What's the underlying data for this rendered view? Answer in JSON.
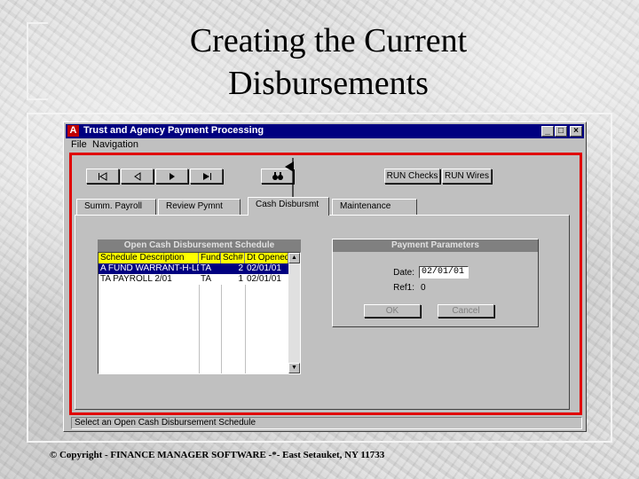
{
  "slide": {
    "title_line1": "Creating the Current",
    "title_line2": "Disbursements",
    "footer": "© Copyright - FINANCE MANAGER SOFTWARE -*- East Setauket, NY 11733"
  },
  "window": {
    "app_icon_letter": "A",
    "title": "Trust and Agency Payment Processing",
    "controls": {
      "minimize": "_",
      "maximize": "□",
      "close": "×"
    }
  },
  "menu": {
    "file": "File",
    "navigation": "Navigation"
  },
  "toolbar": {
    "nav_icons": [
      "first-record-icon",
      "previous-record-icon",
      "next-record-icon",
      "last-record-icon",
      "binoculars-icon"
    ],
    "run_checks": "RUN Checks",
    "run_wires": "RUN Wires"
  },
  "tabs": [
    {
      "label": "Summ. Payroll",
      "active": false
    },
    {
      "label": "Review Pymnt",
      "active": false
    },
    {
      "label": "Cash Disbursmt",
      "active": true
    },
    {
      "label": "Maintenance",
      "active": false
    }
  ],
  "schedule_grid": {
    "title": "Open Cash Disbursement Schedule",
    "columns": [
      "Schedule Description",
      "Fund",
      "Sch#",
      "Dt Opened"
    ],
    "header_color": "#ffff00",
    "selected_color": "#000080",
    "rows": [
      {
        "description": "A FUND WARRANT-H-LD",
        "fund": "TA",
        "sch": "2",
        "opened": "02/01/01",
        "selected": true
      },
      {
        "description": "TA PAYROLL 2/01",
        "fund": "TA",
        "sch": "1",
        "opened": "02/01/01",
        "selected": false
      }
    ]
  },
  "payment_parameters": {
    "title": "Payment Parameters",
    "date_label": "Date:",
    "date_value": "02/01/01",
    "refl_label": "Ref1:",
    "refl_value": "0",
    "ok": "OK",
    "cancel": "Cancel"
  },
  "status_bar": "Select an Open Cash Disbursement Schedule",
  "colors": {
    "highlight_frame": "#e00000",
    "titlebar": "#000080"
  }
}
